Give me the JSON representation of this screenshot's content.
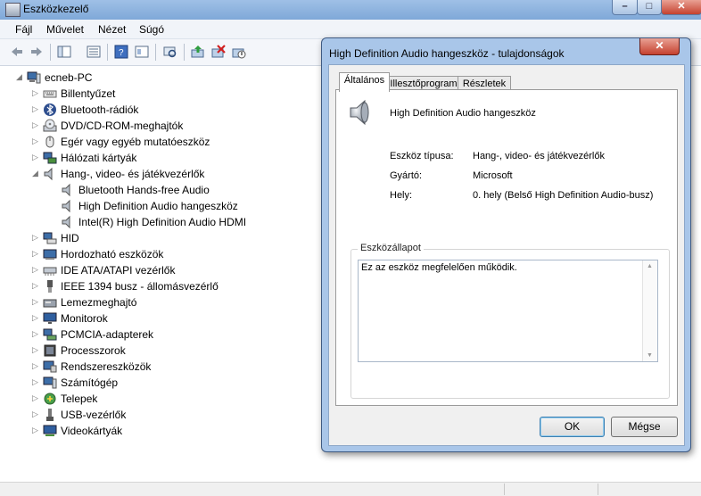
{
  "window": {
    "title": "Eszközkezelő",
    "controls": [
      "–",
      "□",
      "✕"
    ]
  },
  "menu": [
    "Fájl",
    "Művelet",
    "Nézet",
    "Súgó"
  ],
  "tree": {
    "root": "ecneb-PC",
    "items": [
      {
        "label": "Billentyűzet",
        "icon": "keyboard-icon"
      },
      {
        "label": "Bluetooth-rádiók",
        "icon": "bluetooth-icon"
      },
      {
        "label": "DVD/CD-ROM-meghajtók",
        "icon": "disc-drive-icon"
      },
      {
        "label": "Egér vagy egyéb mutatóeszköz",
        "icon": "mouse-icon"
      },
      {
        "label": "Hálózati kártyák",
        "icon": "network-card-icon"
      },
      {
        "label": "Hang-, video- és játékvezérlők",
        "icon": "speaker-icon",
        "expanded": true,
        "children": [
          "Bluetooth Hands-free Audio",
          "High Definition Audio hangeszköz",
          "Intel(R) High Definition Audio HDMI"
        ]
      },
      {
        "label": "HID",
        "icon": "hid-icon"
      },
      {
        "label": "Hordozható eszközök",
        "icon": "portable-device-icon"
      },
      {
        "label": "IDE ATA/ATAPI vezérlők",
        "icon": "ide-controller-icon"
      },
      {
        "label": "IEEE 1394 busz - állomásvezérlő",
        "icon": "firewire-icon"
      },
      {
        "label": "Lemezmeghajtó",
        "icon": "disk-drive-icon"
      },
      {
        "label": "Monitorok",
        "icon": "monitor-icon"
      },
      {
        "label": "PCMCIA-adapterek",
        "icon": "pcmcia-icon"
      },
      {
        "label": "Processzorok",
        "icon": "processor-icon"
      },
      {
        "label": "Rendszereszközök",
        "icon": "system-device-icon"
      },
      {
        "label": "Számítógép",
        "icon": "computer-icon"
      },
      {
        "label": "Telepek",
        "icon": "battery-icon"
      },
      {
        "label": "USB-vezérlők",
        "icon": "usb-icon"
      },
      {
        "label": "Videokártyák",
        "icon": "display-adapter-icon"
      }
    ]
  },
  "dialog": {
    "title": "High Definition Audio hangeszköz - tulajdonságok",
    "close": "✕",
    "tabs": [
      "Általános",
      "Illesztőprogram",
      "Részletek"
    ],
    "device_name": "High Definition Audio hangeszköz",
    "props": [
      {
        "label": "Eszköz típusa:",
        "value": "Hang-, video- és játékvezérlők"
      },
      {
        "label": "Gyártó:",
        "value": "Microsoft"
      },
      {
        "label": "Hely:",
        "value": "0. hely (Belső High Definition Audio-busz)"
      }
    ],
    "status_group": "Eszközállapot",
    "status_text": "Ez az eszköz megfelelően működik.",
    "ok": "OK",
    "cancel": "Mégse"
  },
  "colors": {
    "title_bar": "#9fc0e6",
    "dialog_frame": "#a9c6e9",
    "close_button": "#c5412f"
  }
}
